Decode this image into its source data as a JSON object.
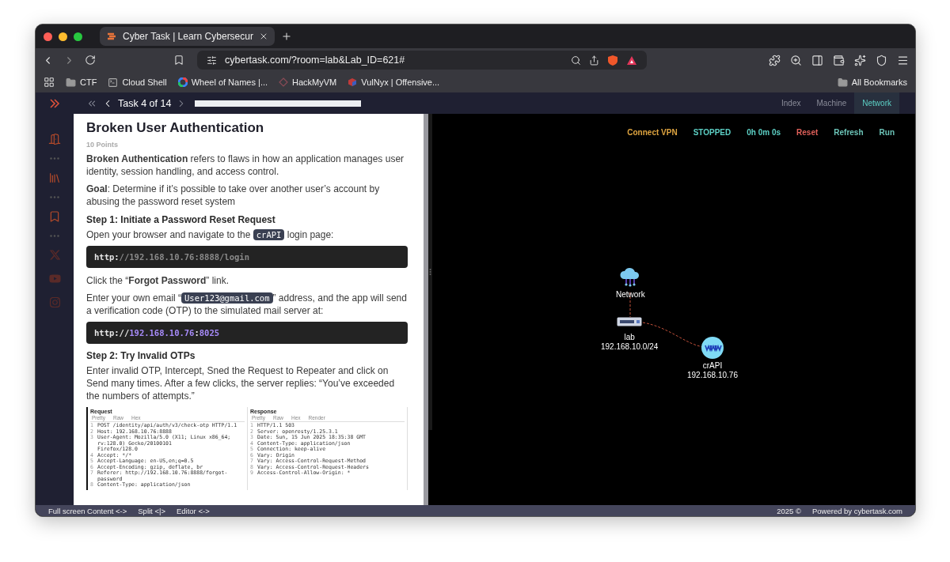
{
  "browser": {
    "tab": {
      "title": "Cyber Task | Learn Cybersecur",
      "selected": true
    },
    "url": "cybertask.com/?room=lab&Lab_ID=621#",
    "bookmarks": [
      {
        "label": "CTF",
        "kind": "folder"
      },
      {
        "label": "Cloud Shell",
        "kind": "shell"
      },
      {
        "label": "Wheel of Names |...",
        "kind": "wheel"
      },
      {
        "label": "HackMyVM",
        "kind": "diamond"
      },
      {
        "label": "VulNyx | Offensive...",
        "kind": "cube"
      }
    ],
    "all_bookmarks": "All Bookmarks"
  },
  "task_nav": {
    "label": "Task 4 of 14"
  },
  "view_tabs": [
    {
      "label": "Index",
      "selected": false
    },
    {
      "label": "Machine",
      "selected": false
    },
    {
      "label": "Network",
      "selected": true
    }
  ],
  "lesson": {
    "title": "Broken User Authentication",
    "points": "10 Points",
    "blocks": [
      {
        "kind": "text",
        "parts": [
          {
            "kind": "text",
            "text": "**Broken Authentication** refers to flaws in how an application manages user identity, session handling, and access control."
          }
        ]
      },
      {
        "kind": "text",
        "parts": [
          {
            "kind": "text",
            "text": "**Goal**: Determine if it’s possible to take over another user’s account by abusing the password reset system"
          }
        ]
      },
      {
        "kind": "heading",
        "text": "Step 1: Initiate a Password Reset Request"
      },
      {
        "kind": "text",
        "parts": [
          {
            "kind": "text",
            "text": "Open your browser and navigate to the "
          },
          {
            "kind": "code",
            "text": "crAPI"
          },
          {
            "kind": "text",
            "text": " login page:"
          }
        ]
      },
      {
        "kind": "code",
        "tokens": [
          {
            "text": "http:",
            "color": "#e6e6e6"
          },
          {
            "text": "//192.168.10.76:8888/login",
            "color": "#8a8a8a"
          }
        ]
      },
      {
        "kind": "text",
        "parts": [
          {
            "kind": "text",
            "text": "Click the “**Forgot Password**” link."
          }
        ]
      },
      {
        "kind": "text",
        "parts": [
          {
            "kind": "text",
            "text": "Enter your own email “"
          },
          {
            "kind": "code",
            "text": "User123@gmail.com"
          },
          {
            "kind": "text",
            "text": "” address, and the app will send a verification code (OTP) to the simulated mail server at:"
          }
        ]
      },
      {
        "kind": "code",
        "tokens": [
          {
            "text": "http://",
            "color": "#e6e6e6"
          },
          {
            "text": "192.168.10.76",
            "color": "#a78bfa"
          },
          {
            "text": ":",
            "color": "#e6e6e6"
          },
          {
            "text": "8025",
            "color": "#a78bfa"
          }
        ]
      },
      {
        "kind": "heading",
        "text": "Step 2: Try Invalid OTPs"
      },
      {
        "kind": "text",
        "parts": [
          {
            "kind": "text",
            "text": "Enter invalid OTP, Intercept, Sned the Request to Repeater and click on Send many times. After a few clicks, the server replies: “You’ve exceeded the numbers of attempts.”"
          }
        ]
      },
      {
        "kind": "screenshot",
        "panes": [
          {
            "title": "Request",
            "tabs": [
              "Pretty",
              "Raw",
              "Hex"
            ],
            "lines": [
              {
                "num": "1",
                "text": "POST /identity/api/auth/v3/check-otp HTTP/1.1"
              },
              {
                "num": "2",
                "text": "Host: 192.168.10.76:8888"
              },
              {
                "num": "3",
                "text": "User-Agent: Mozilla/5.0 (X11; Linux x86_64; rv:128.0) Gecko/20100101"
              },
              {
                "text": "Firefox/128.0"
              },
              {
                "num": "4",
                "text": "Accept: */*"
              },
              {
                "num": "5",
                "text": "Accept-Language: en-US,en;q=0.5"
              },
              {
                "num": "6",
                "text": "Accept-Encoding: gzip, deflate, br"
              },
              {
                "num": "7",
                "text": "Referer: http://192.168.10.76:8888/forgot-password"
              },
              {
                "num": "8",
                "text": "Content-Type: application/json"
              }
            ]
          },
          {
            "title": "Response",
            "tabs": [
              "Pretty",
              "Raw",
              "Hex",
              "Render"
            ],
            "lines": [
              {
                "num": "1",
                "text": "HTTP/1.1 503"
              },
              {
                "num": "2",
                "text": "Server: openresty/1.25.3.1"
              },
              {
                "num": "3",
                "text": "Date: Sun, 15 Jun 2025 18:35:38 GMT"
              },
              {
                "num": "4",
                "text": "Content-Type: application/json"
              },
              {
                "num": "5",
                "text": "Connection: keep-alive"
              },
              {
                "num": "6",
                "text": "Vary: Origin"
              },
              {
                "num": "7",
                "text": "Vary: Access-Control-Request-Method"
              },
              {
                "num": "8",
                "text": "Vary: Access-Control-Request-Headers"
              },
              {
                "num": "9",
                "text": "Access-Control-Allow-Origin: *"
              }
            ]
          }
        ]
      }
    ]
  },
  "controls": [
    {
      "label": "Connect VPN",
      "color": "#e0a540"
    },
    {
      "label": "STOPPED",
      "color": "#5ccfc4"
    },
    {
      "label": "0h 0m 0s",
      "color": "#5ccfc4"
    },
    {
      "label": "Reset",
      "color": "#e0605a"
    },
    {
      "label": "Refresh",
      "color": "#6cc4b8"
    },
    {
      "label": "Run",
      "color": "#6cc4b8"
    }
  ],
  "network": {
    "nodes": [
      {
        "kind": "cloud",
        "name": "Network"
      },
      {
        "kind": "switch",
        "name": "lab",
        "address": "192.168.10.0/24"
      },
      {
        "kind": "web",
        "name": "crAPI",
        "address": "192.168.10.76"
      }
    ]
  },
  "footer": {
    "links": [
      "Full screen Content <->",
      "Split <|>",
      "Editor <->"
    ],
    "copyright": "2025 ©",
    "powered": "Powered by cybertask.com"
  }
}
